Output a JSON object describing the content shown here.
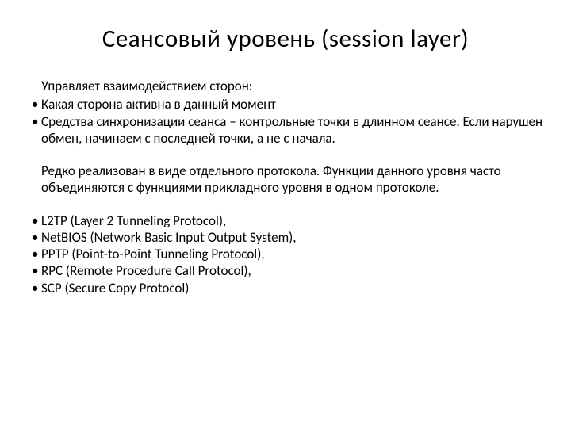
{
  "title": "Сеансовый уровень (session layer)",
  "intro": "Управляет взаимодействием сторон:",
  "bullets1": [
    "Какая сторона активна в данный момент",
    "Средства синхронизации сеанса – контрольные точки в длинном сеансе. Если нарушен обмен, начинаем с последней точки, а не с начала."
  ],
  "paragraph": "Редко реализован в виде отдельного протокола. Функции данного уровня часто объединяются с функциями прикладного уровня в одном протоколе.",
  "protocols": [
    "L2TP (Layer 2 Tunneling Protocol),",
    "NetBIOS (Network Basic Input Output System),",
    "PPTP (Point-to-Point Tunneling Protocol),",
    "RPC (Remote Procedure Call Protocol),",
    "SCP (Secure Copy Protocol)"
  ]
}
